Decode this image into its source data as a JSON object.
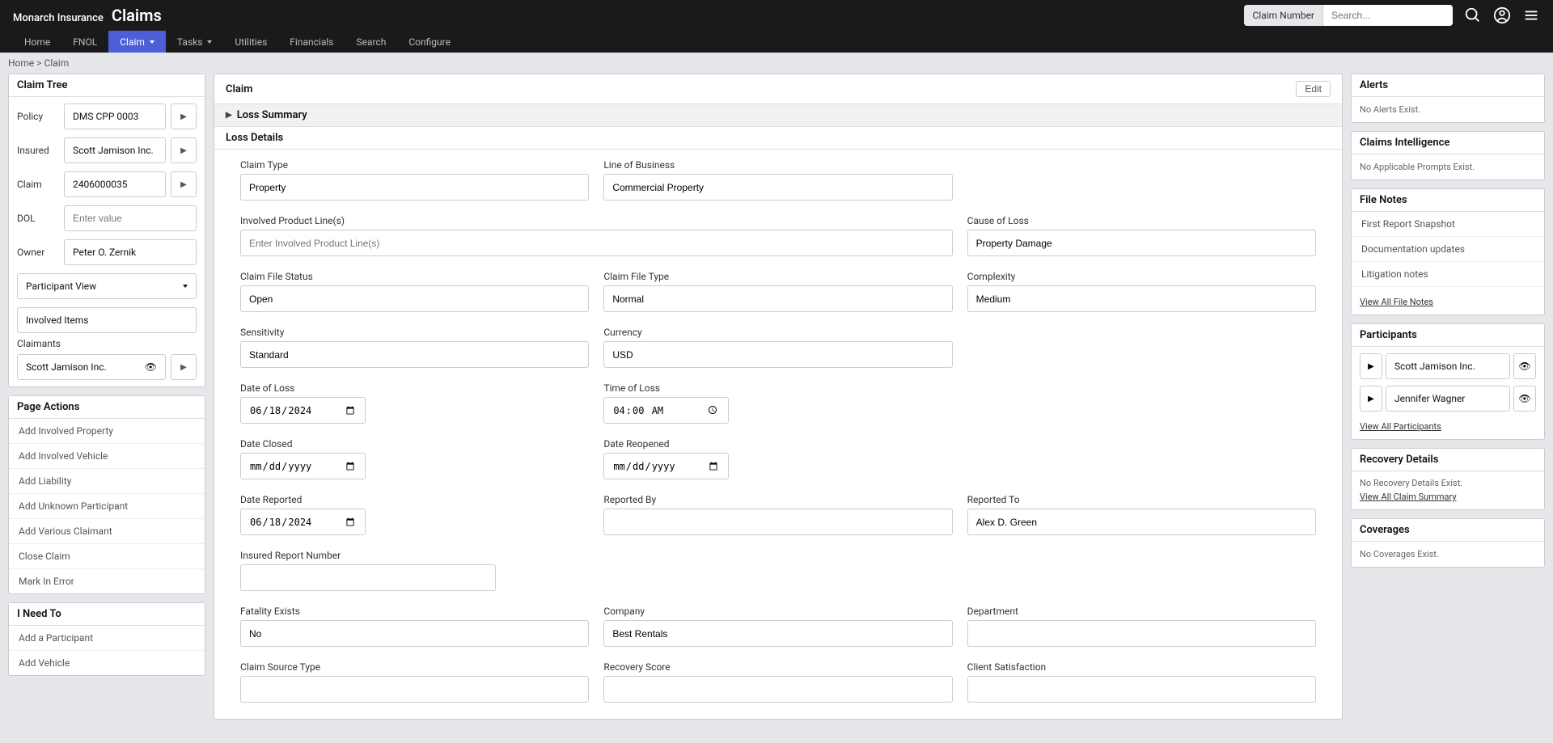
{
  "brand": {
    "company": "Monarch Insurance",
    "app": "Claims"
  },
  "search": {
    "label": "Claim Number",
    "placeholder": "Search..."
  },
  "nav": {
    "items": [
      "Home",
      "FNOL",
      "Claim",
      "Tasks",
      "Utilities",
      "Financials",
      "Search",
      "Configure"
    ],
    "active_index": 2
  },
  "breadcrumb": {
    "home": "Home",
    "sep": ">",
    "current": "Claim"
  },
  "claim_tree": {
    "title": "Claim Tree",
    "policy_label": "Policy",
    "policy_value": "DMS CPP 0003",
    "insured_label": "Insured",
    "insured_value": "Scott Jamison Inc.",
    "claim_label": "Claim",
    "claim_value": "2406000035",
    "dol_label": "DOL",
    "dol_placeholder": "Enter value",
    "owner_label": "Owner",
    "owner_value": "Peter O. Zernik",
    "view_selected": "Participant View",
    "involved_items": "Involved Items",
    "claimants_label": "Claimants",
    "claimant1": "Scott Jamison Inc."
  },
  "page_actions": {
    "title": "Page Actions",
    "items": [
      "Add Involved Property",
      "Add Involved Vehicle",
      "Add Liability",
      "Add Unknown Participant",
      "Add Various Claimant",
      "Close Claim",
      "Mark In Error"
    ]
  },
  "need_to": {
    "title": "I Need To",
    "items": [
      "Add a Participant",
      "Add Vehicle"
    ]
  },
  "main": {
    "title": "Claim",
    "edit": "Edit",
    "loss_summary": "Loss Summary",
    "loss_details": "Loss Details",
    "fields": {
      "claim_type": {
        "label": "Claim Type",
        "value": "Property"
      },
      "lob": {
        "label": "Line of Business",
        "value": "Commercial Property"
      },
      "product_lines": {
        "label": "Involved Product Line(s)",
        "placeholder": "Enter Involved Product Line(s)"
      },
      "cause": {
        "label": "Cause of Loss",
        "value": "Property Damage"
      },
      "file_status": {
        "label": "Claim File Status",
        "value": "Open"
      },
      "file_type": {
        "label": "Claim File Type",
        "value": "Normal"
      },
      "complexity": {
        "label": "Complexity",
        "value": "Medium"
      },
      "sensitivity": {
        "label": "Sensitivity",
        "value": "Standard"
      },
      "currency": {
        "label": "Currency",
        "value": "USD"
      },
      "dol": {
        "label": "Date of Loss",
        "value": "2024-06-18"
      },
      "tol": {
        "label": "Time of Loss",
        "value": "04:00"
      },
      "date_closed": {
        "label": "Date Closed",
        "value": ""
      },
      "date_reopened": {
        "label": "Date Reopened",
        "value": ""
      },
      "date_reported": {
        "label": "Date Reported",
        "value": "2024-06-18"
      },
      "reported_by": {
        "label": "Reported By",
        "value": ""
      },
      "reported_to": {
        "label": "Reported To",
        "value": "Alex D. Green"
      },
      "insured_report_num": {
        "label": "Insured Report Number",
        "value": ""
      },
      "fatality": {
        "label": "Fatality Exists",
        "value": "No"
      },
      "company": {
        "label": "Company",
        "value": "Best Rentals"
      },
      "department": {
        "label": "Department",
        "value": ""
      },
      "source_type": {
        "label": "Claim Source Type",
        "value": ""
      },
      "recovery_score": {
        "label": "Recovery Score",
        "value": ""
      },
      "satisfaction": {
        "label": "Client Satisfaction",
        "value": ""
      }
    }
  },
  "alerts": {
    "title": "Alerts",
    "msg": "No Alerts Exist."
  },
  "intelligence": {
    "title": "Claims Intelligence",
    "msg": "No Applicable Prompts Exist."
  },
  "file_notes": {
    "title": "File Notes",
    "items": [
      "First Report Snapshot",
      "Documentation updates",
      "Litigation notes"
    ],
    "view_all": "View All File Notes"
  },
  "participants": {
    "title": "Participants",
    "items": [
      "Scott Jamison Inc.",
      "Jennifer Wagner"
    ],
    "view_all": "View All Participants"
  },
  "recovery": {
    "title": "Recovery Details",
    "msg": "No Recovery Details Exist.",
    "link": "View All Claim Summary"
  },
  "coverages": {
    "title": "Coverages",
    "msg": "No Coverages Exist."
  }
}
